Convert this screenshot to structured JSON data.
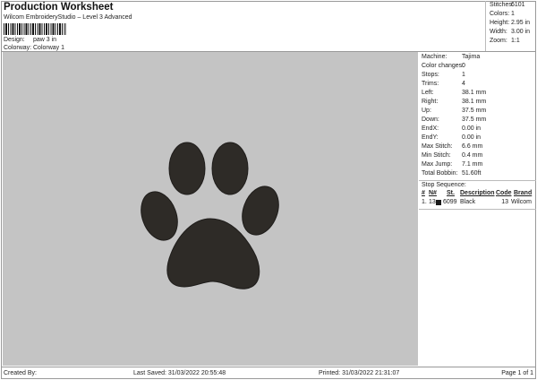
{
  "header": {
    "title": "Production Worksheet",
    "subtitle": "Wilcom EmbroideryStudio – Level 3 Advanced",
    "design_label": "Design:",
    "design": "paw 3 in",
    "colorway_label": "Colorway:",
    "colorway": "Colorway 1"
  },
  "stats": [
    {
      "k": "Stitches:",
      "v": "6101"
    },
    {
      "k": "Colors:",
      "v": "1"
    },
    {
      "k": "Height:",
      "v": "2.95 in"
    },
    {
      "k": "Width:",
      "v": "3.00 in"
    },
    {
      "k": "Zoom:",
      "v": "1:1"
    }
  ],
  "details": [
    {
      "k": "Machine:",
      "v": "Tajima"
    },
    {
      "k": "Color changes:",
      "v": "0"
    },
    {
      "k": "Stops:",
      "v": "1"
    },
    {
      "k": "Trims:",
      "v": "4"
    },
    {
      "k": "Left:",
      "v": "38.1 mm"
    },
    {
      "k": "Right:",
      "v": "38.1 mm"
    },
    {
      "k": "Up:",
      "v": "37.5 mm"
    },
    {
      "k": "Down:",
      "v": "37.5 mm"
    },
    {
      "k": "EndX:",
      "v": "0.00 in"
    },
    {
      "k": "EndY:",
      "v": "0.00 in"
    },
    {
      "k": "Max Stitch:",
      "v": "6.6 mm"
    },
    {
      "k": "Min Stitch:",
      "v": "0.4 mm"
    },
    {
      "k": "Max Jump:",
      "v": "7.1 mm"
    },
    {
      "k": "Total Bobbin:",
      "v": "51.60ft"
    }
  ],
  "stop_sequence": {
    "label": "Stop Sequence:",
    "headers": [
      "#",
      "N#",
      "St.",
      "Description",
      "Code",
      "Brand"
    ],
    "rows": [
      {
        "num": "1.",
        "n": "13",
        "color": "#1a1a1a",
        "st": "6099",
        "desc": "Black",
        "code": "13",
        "brand": "Wilcom"
      }
    ]
  },
  "footer": {
    "created": "Created By:",
    "saved": "Last Saved: 31/03/2022 20:55:48",
    "printed": "Printed: 31/03/2022 21:31:07",
    "page": "Page 1 of 1"
  },
  "colors": {
    "canvas": "#c4c4c4",
    "thread": "#2e2b27"
  }
}
